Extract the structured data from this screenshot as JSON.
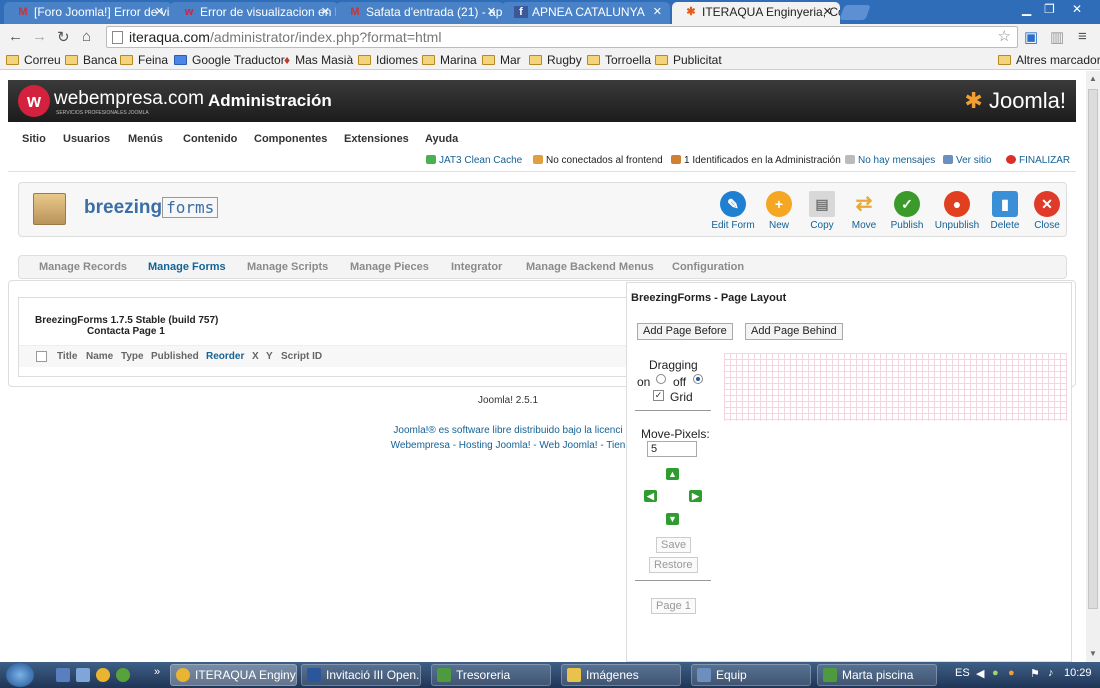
{
  "browser": {
    "tabs": [
      {
        "title": "[Foro Joomla!] Error de vis",
        "icon": "gmail-icon"
      },
      {
        "title": "Error de visualizacion en B",
        "icon": "webempresa-icon"
      },
      {
        "title": "Safata d'entrada (21) - apr",
        "icon": "gmail-icon"
      },
      {
        "title": "APNEA CATALUNYA",
        "icon": "facebook-icon"
      },
      {
        "title": "ITERAQUA Enginyeria, Co",
        "icon": "joomla-icon"
      }
    ],
    "url_host": "iteraqua.com",
    "url_path": "/administrator/index.php?format=html",
    "bookmarks": [
      "Correu",
      "Banca",
      "Feina",
      "Google Traductor",
      "Mas Masià",
      "Idiomes",
      "Marina",
      "Mar",
      "Rugby",
      "Torroella",
      "Publicitat"
    ],
    "other_bookmarks": "Altres marcadors"
  },
  "header": {
    "brand": "webempresa.com",
    "brand_sub": "SERVICIOS PROFESIONALES JOOMLA",
    "title": "Administración",
    "joomla": "Joomla!"
  },
  "menu": {
    "items": [
      "Sitio",
      "Usuarios",
      "Menús",
      "Contenido",
      "Componentes",
      "Extensiones",
      "Ayuda"
    ],
    "status": {
      "cache": "JAT3 Clean Cache",
      "frontend": "No conectados al frontend",
      "admin": "1 Identificados en la Administración",
      "messages": "No hay mensajes",
      "site": "Ver sitio",
      "logout": "FINALIZAR"
    }
  },
  "component": {
    "logo_bold": "breezing",
    "logo_thin": "forms",
    "toolbar": [
      {
        "label": "Edit Form",
        "color": "#1f7fd0",
        "glyph": "✎"
      },
      {
        "label": "New",
        "color": "#f5a623",
        "glyph": "+"
      },
      {
        "label": "Copy",
        "color": "#d8d8d8",
        "glyph": "▤"
      },
      {
        "label": "Move",
        "color": "#f2c46a",
        "glyph": "⇄"
      },
      {
        "label": "Publish",
        "color": "#3a9a2a",
        "glyph": "✓"
      },
      {
        "label": "Unpublish",
        "color": "#e04020",
        "glyph": "●"
      },
      {
        "label": "Delete",
        "color": "#3a8fd6",
        "glyph": "▮"
      },
      {
        "label": "Close",
        "color": "#e03a2a",
        "glyph": "✕"
      }
    ]
  },
  "submenu": [
    "Manage Records",
    "Manage Forms",
    "Manage Scripts",
    "Manage Pieces",
    "Integrator",
    "Manage Backend Menus",
    "Configuration"
  ],
  "content": {
    "version": "BreezingForms 1.7.5 Stable (build 757)",
    "page": "Contacta Page 1",
    "columns": [
      "Title",
      "Name",
      "Type",
      "Published",
      "Reorder",
      "X",
      "Y",
      "Script ID"
    ]
  },
  "footer": {
    "version": "Joomla! 2.5.1",
    "line1": "Joomla!® es software libre distribuido bajo la licenci",
    "line2": "Webempresa - Hosting Joomla! - Web Joomla! - Tien"
  },
  "layout": {
    "title": "BreezingForms - Page Layout",
    "add_before": "Add Page Before",
    "add_behind": "Add Page Behind",
    "dragging": "Dragging",
    "on": "on",
    "off": "off",
    "grid": "Grid",
    "move_pixels_label": "Move-Pixels:",
    "move_pixels_value": "5",
    "save": "Save",
    "restore": "Restore",
    "page": "Page 1"
  },
  "taskbar": {
    "tasks": [
      "ITERAQUA Enginy...",
      "Invitació III Open...",
      "Tresoreria",
      "Imágenes",
      "Equip",
      "Marta piscina"
    ],
    "lang": "ES",
    "time": "10:29"
  }
}
